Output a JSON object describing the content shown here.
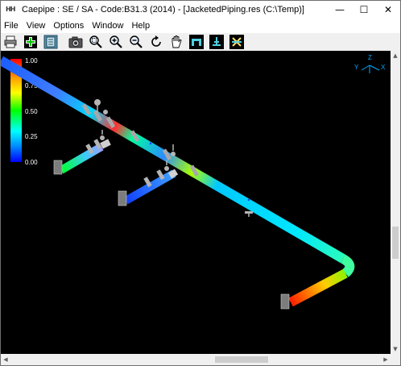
{
  "window": {
    "app_icon": "HH",
    "title": "Caepipe : SE / SA - Code:B31.3 (2014) - [JacketedPiping.res (C:\\Temp)]",
    "controls": {
      "minimize": "—",
      "maximize": "☐",
      "close": "✕"
    }
  },
  "menu": {
    "items": [
      {
        "label": "File"
      },
      {
        "label": "View"
      },
      {
        "label": "Options"
      },
      {
        "label": "Window"
      },
      {
        "label": "Help"
      }
    ]
  },
  "toolbar": {
    "buttons": [
      {
        "icon": "print-icon"
      },
      {
        "icon": "add-frame-icon"
      },
      {
        "icon": "notepad-icon"
      },
      {
        "icon": "camera-icon"
      },
      {
        "icon": "zoom-window-icon"
      },
      {
        "icon": "zoom-in-icon"
      },
      {
        "icon": "zoom-out-icon"
      },
      {
        "icon": "rotate-icon"
      },
      {
        "icon": "pan-hand-icon"
      },
      {
        "icon": "view-front-icon"
      },
      {
        "icon": "view-side-icon"
      },
      {
        "icon": "view-top-icon"
      }
    ]
  },
  "legend": {
    "labels": [
      "1.00",
      "0.75",
      "0.50",
      "0.25",
      "0.00"
    ],
    "values": [
      1.0,
      0.75,
      0.5,
      0.25,
      0.0
    ]
  },
  "triad": {
    "z": "Z",
    "y": "Y",
    "x": "X"
  },
  "colors": {
    "viewport_bg": "#000000",
    "stress_high": "#ff0000",
    "stress_mid": "#00ff00",
    "stress_low": "#0000ff",
    "valve_gray": "#b4b4b4"
  }
}
